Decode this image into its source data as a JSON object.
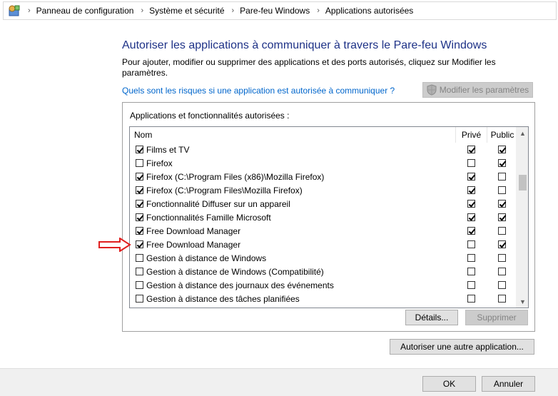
{
  "breadcrumb": {
    "items": [
      "Panneau de configuration",
      "Système et sécurité",
      "Pare-feu Windows",
      "Applications autorisées"
    ]
  },
  "title": "Autoriser les applications à communiquer à travers le Pare-feu Windows",
  "description": "Pour ajouter, modifier ou supprimer des applications et des ports autorisés, cliquez sur Modifier les paramètres.",
  "risk_link": "Quels sont les risques si une application est autorisée à communiquer ?",
  "modify_button": "Modifier les paramètres",
  "group_label": "Applications et fonctionnalités autorisées :",
  "columns": {
    "name": "Nom",
    "private": "Privé",
    "public": "Public"
  },
  "apps": [
    {
      "name": "Films et TV",
      "enabled": true,
      "private": true,
      "public": true
    },
    {
      "name": "Firefox",
      "enabled": false,
      "private": false,
      "public": true
    },
    {
      "name": "Firefox (C:\\Program Files (x86)\\Mozilla Firefox)",
      "enabled": true,
      "private": true,
      "public": false
    },
    {
      "name": "Firefox (C:\\Program Files\\Mozilla Firefox)",
      "enabled": true,
      "private": true,
      "public": false
    },
    {
      "name": "Fonctionnalité Diffuser sur un appareil",
      "enabled": true,
      "private": true,
      "public": true
    },
    {
      "name": "Fonctionnalités Famille Microsoft",
      "enabled": true,
      "private": true,
      "public": true
    },
    {
      "name": "Free Download Manager",
      "enabled": true,
      "private": true,
      "public": false
    },
    {
      "name": "Free Download Manager",
      "enabled": true,
      "private": false,
      "public": true
    },
    {
      "name": "Gestion à distance de Windows",
      "enabled": false,
      "private": false,
      "public": false
    },
    {
      "name": "Gestion à distance de Windows (Compatibilité)",
      "enabled": false,
      "private": false,
      "public": false
    },
    {
      "name": "Gestion à distance des journaux des événements",
      "enabled": false,
      "private": false,
      "public": false
    },
    {
      "name": "Gestion à distance des tâches planifiées",
      "enabled": false,
      "private": false,
      "public": false
    }
  ],
  "details_button": "Détails...",
  "delete_button": "Supprimer",
  "allow_other_button": "Autoriser une autre application...",
  "ok_button": "OK",
  "cancel_button": "Annuler",
  "colors": {
    "title": "#1e3287",
    "link": "#0066cc",
    "arrow": "#e02020"
  }
}
